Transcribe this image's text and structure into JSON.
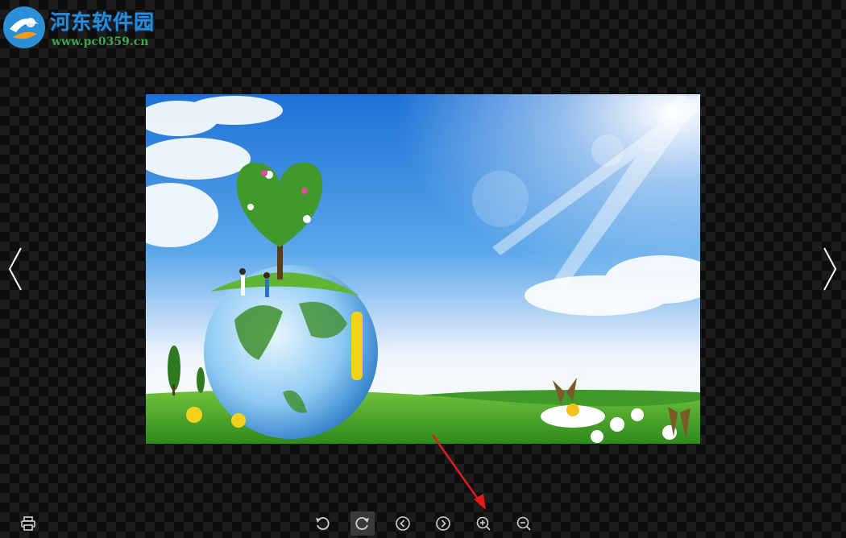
{
  "watermark": {
    "title": "河东软件园",
    "url": "www.pc0359.cn"
  },
  "viewer": {
    "image_icon": "landscape-photo",
    "nav_prev_icon": "chevron-left-icon",
    "nav_next_icon": "chevron-right-icon"
  },
  "toolbar": {
    "print_icon": "printer-icon",
    "rotate_left_icon": "rotate-left-icon",
    "rotate_right_icon": "rotate-right-icon",
    "previous_icon": "circle-chevron-left-icon",
    "next_icon": "circle-chevron-right-icon",
    "zoom_in_icon": "zoom-in-icon",
    "zoom_out_icon": "zoom-out-icon",
    "active_tool": "rotate-right"
  },
  "annotation": {
    "color": "#e11b1b",
    "points_to": "zoom-in-button"
  },
  "colors": {
    "watermark_title": "#2b8bd8",
    "watermark_url": "#3aa84a",
    "toolbar_icon": "#cfcfcf"
  }
}
